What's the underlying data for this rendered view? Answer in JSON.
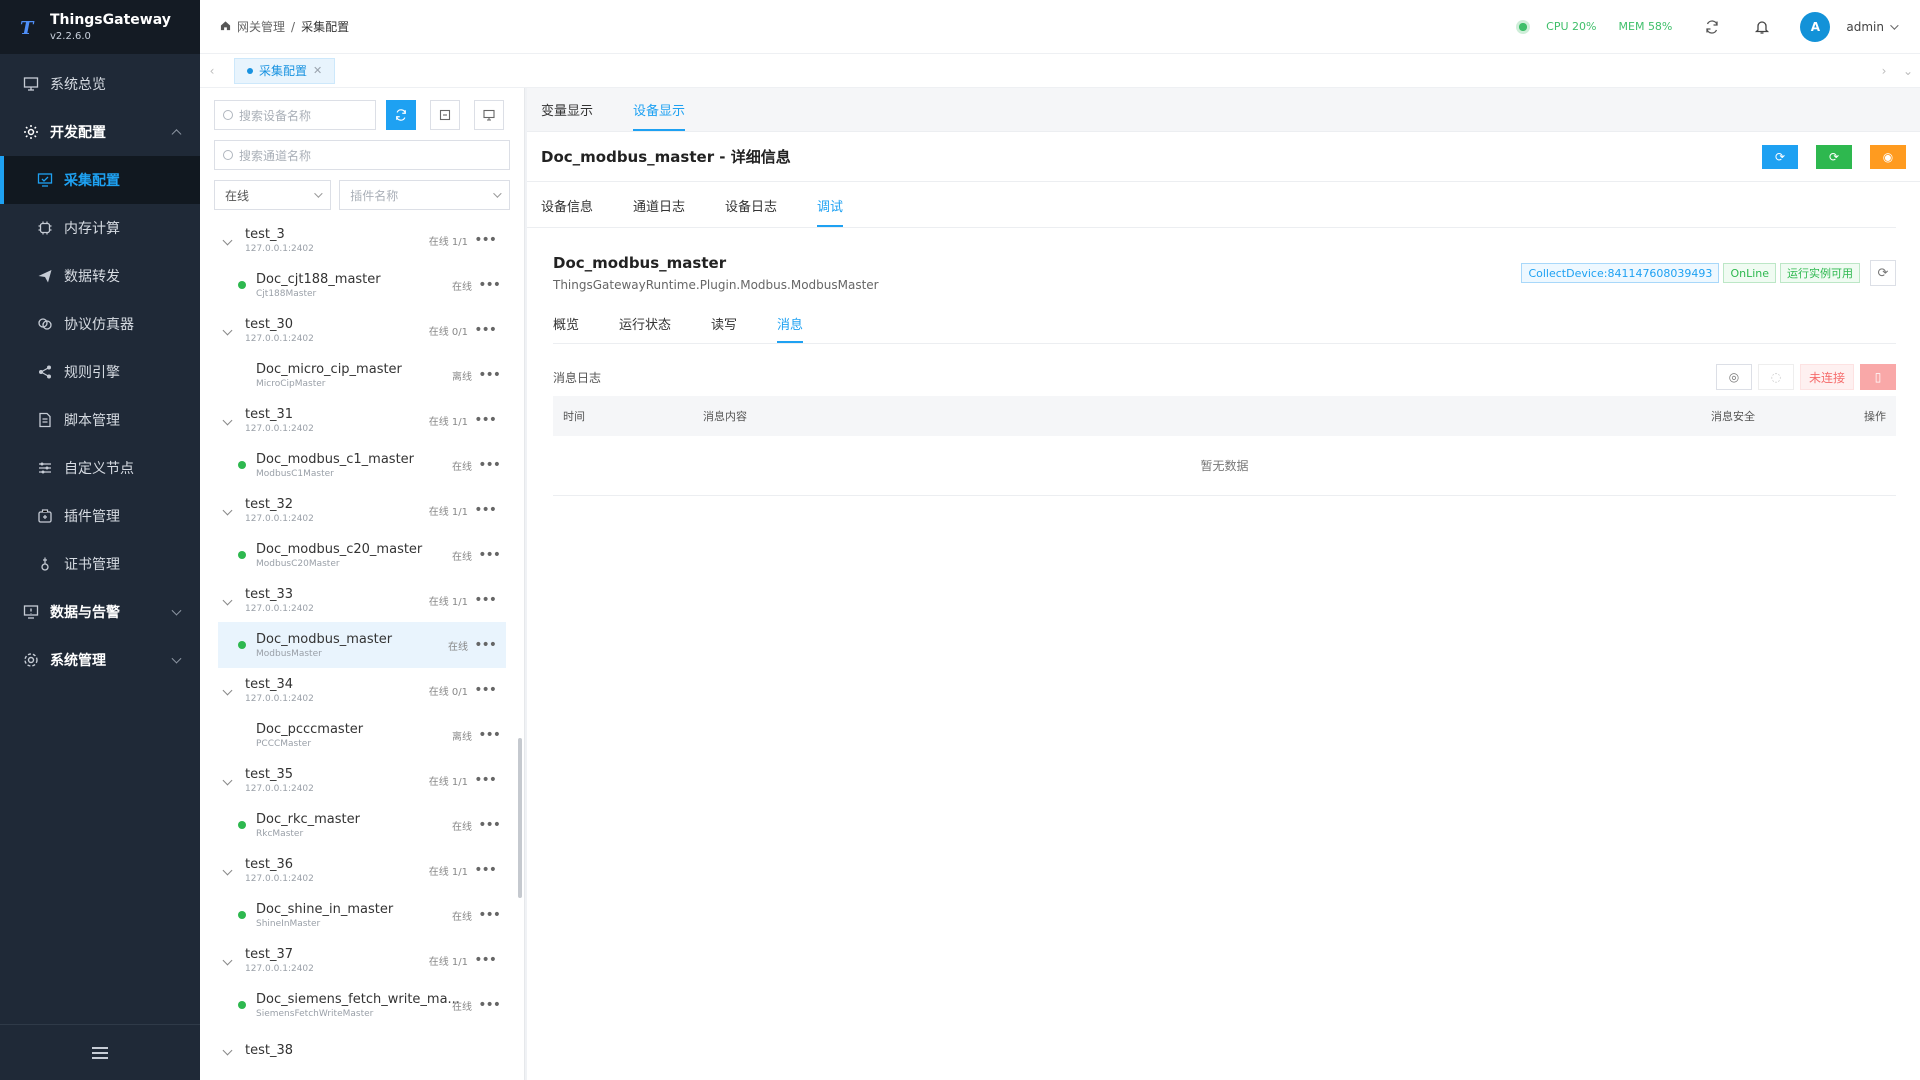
{
  "brand": {
    "name": "ThingsGateway",
    "version": "v2.2.6.0",
    "logo_icon": "T"
  },
  "sidebar": {
    "items": [
      {
        "label": "系统总览",
        "icon": "monitor-icon",
        "type": "top"
      },
      {
        "label": "开发配置",
        "icon": "gear-icon",
        "type": "group"
      },
      {
        "label": "采集配置",
        "icon": "collect-icon",
        "type": "sub-active"
      },
      {
        "label": "内存计算",
        "icon": "chip-icon",
        "type": "sub"
      },
      {
        "label": "数据转发",
        "icon": "send-icon",
        "type": "sub"
      },
      {
        "label": "协议仿真器",
        "icon": "simulator-icon",
        "type": "sub"
      },
      {
        "label": "规则引擎",
        "icon": "share-icon",
        "type": "sub"
      },
      {
        "label": "脚本管理",
        "icon": "script-icon",
        "type": "sub"
      },
      {
        "label": "自定义节点",
        "icon": "sliders-icon",
        "type": "sub"
      },
      {
        "label": "插件管理",
        "icon": "plugin-icon",
        "type": "sub"
      },
      {
        "label": "证书管理",
        "icon": "cert-icon",
        "type": "sub"
      },
      {
        "label": "数据与告警",
        "icon": "alarm-icon",
        "type": "group-collapsed"
      },
      {
        "label": "系统管理",
        "icon": "settings-icon",
        "type": "group-collapsed"
      }
    ]
  },
  "header": {
    "breadcrumb": [
      "网关管理",
      "采集配置"
    ],
    "cpu_label": "CPU",
    "cpu_value": "20%",
    "mem_label": "MEM",
    "mem_value": "58%",
    "user_initial": "A",
    "user_name": "admin"
  },
  "tabstrip": {
    "active_tab": "采集配置"
  },
  "left": {
    "search_device_placeholder": "搜索设备名称",
    "search_channel_placeholder": "搜索通道名称",
    "status_filter": "在线",
    "plugin_placeholder": "插件名称",
    "tree": [
      {
        "group": "test_3",
        "ip": "127.0.0.1:2402",
        "status": "在线 1/1",
        "device": "Doc_cjt188_master",
        "plugin": "Cjt188Master",
        "dstatus": "在线",
        "online": true,
        "selected": false
      },
      {
        "group": "test_30",
        "ip": "127.0.0.1:2402",
        "status": "在线 0/1",
        "device": "Doc_micro_cip_master",
        "plugin": "MicroCipMaster",
        "dstatus": "离线",
        "online": false,
        "selected": false
      },
      {
        "group": "test_31",
        "ip": "127.0.0.1:2402",
        "status": "在线 1/1",
        "device": "Doc_modbus_c1_master",
        "plugin": "ModbusC1Master",
        "dstatus": "在线",
        "online": true,
        "selected": false
      },
      {
        "group": "test_32",
        "ip": "127.0.0.1:2402",
        "status": "在线 1/1",
        "device": "Doc_modbus_c20_master",
        "plugin": "ModbusC20Master",
        "dstatus": "在线",
        "online": true,
        "selected": false
      },
      {
        "group": "test_33",
        "ip": "127.0.0.1:2402",
        "status": "在线 1/1",
        "device": "Doc_modbus_master",
        "plugin": "ModbusMaster",
        "dstatus": "在线",
        "online": true,
        "selected": true
      },
      {
        "group": "test_34",
        "ip": "127.0.0.1:2402",
        "status": "在线 0/1",
        "device": "Doc_pcccmaster",
        "plugin": "PCCCMaster",
        "dstatus": "离线",
        "online": false,
        "selected": false
      },
      {
        "group": "test_35",
        "ip": "127.0.0.1:2402",
        "status": "在线 1/1",
        "device": "Doc_rkc_master",
        "plugin": "RkcMaster",
        "dstatus": "在线",
        "online": true,
        "selected": false
      },
      {
        "group": "test_36",
        "ip": "127.0.0.1:2402",
        "status": "在线 1/1",
        "device": "Doc_shine_in_master",
        "plugin": "ShineInMaster",
        "dstatus": "在线",
        "online": true,
        "selected": false
      },
      {
        "group": "test_37",
        "ip": "127.0.0.1:2402",
        "status": "在线 1/1",
        "device": "Doc_siemens_fetch_write_ma...",
        "plugin": "SiemensFetchWriteMaster",
        "dstatus": "在线",
        "online": true,
        "selected": false
      }
    ],
    "partial_group": "test_38"
  },
  "right": {
    "top_tabs": [
      "变量显示",
      "设备显示"
    ],
    "detail_title": "Doc_modbus_master - 详细信息",
    "sub_tabs": [
      "设备信息",
      "通道日志",
      "设备日志",
      "调试"
    ],
    "device_name": "Doc_modbus_master",
    "device_type": "ThingsGatewayRuntime.Plugin.Modbus.ModbusMaster",
    "badges": {
      "collect": "CollectDevice:841147608039493",
      "online": "OnLine",
      "instance": "运行实例可用"
    },
    "inner_tabs": [
      "概览",
      "运行状态",
      "读写",
      "消息"
    ],
    "log_title": "消息日志",
    "not_connected": "未连接",
    "table_headers": [
      "时间",
      "消息内容",
      "消息安全",
      "操作"
    ],
    "empty_text": "暂无数据"
  },
  "colors": {
    "accent": "#1ea1f2",
    "online": "#2eb84f",
    "sidebar_bg": "#1f2937",
    "warn": "#ff9b1f",
    "danger": "#f56c6c"
  }
}
